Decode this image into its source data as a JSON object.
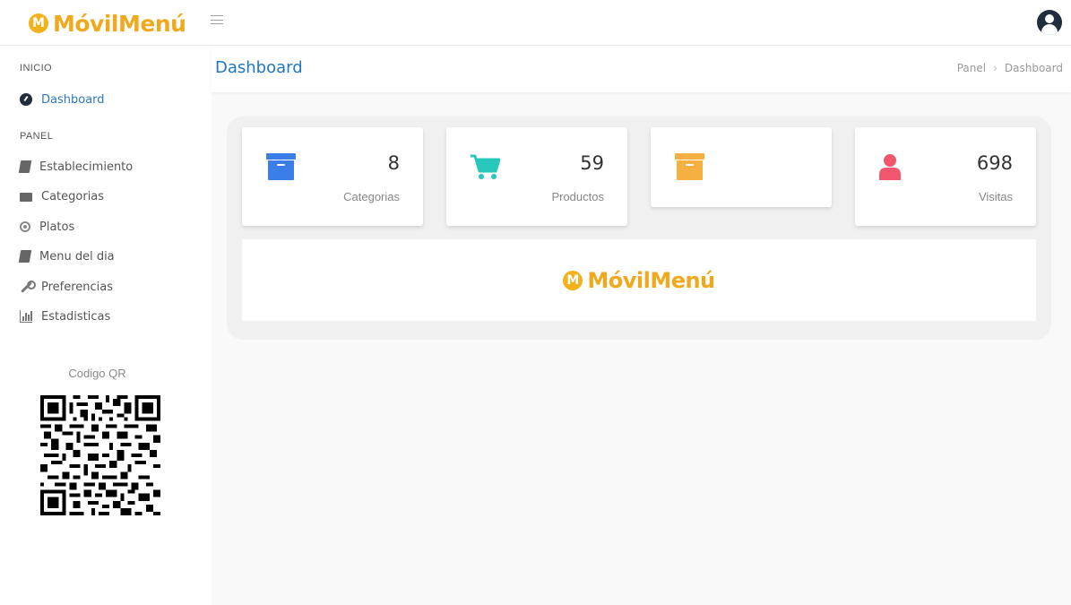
{
  "app": {
    "brand_badge": "M",
    "brand_name": "MóvilMenú"
  },
  "colors": {
    "brand": "#f0a91c",
    "accent": "#1f77c4",
    "categorias_icon": "#3b7de9",
    "productos_icon": "#27c8bb",
    "third_icon": "#f5b041",
    "visitas_icon": "#f0566e"
  },
  "topbar": {
    "menu_icon": "hamburger-icon",
    "user_icon": "user-circle-icon"
  },
  "sidebar": {
    "sections": [
      {
        "title": "INICIO",
        "items": [
          {
            "label": "Dashboard",
            "icon": "dashboard-icon",
            "active": true
          }
        ]
      },
      {
        "title": "PANEL",
        "items": [
          {
            "label": "Establecimiento",
            "icon": "book-icon"
          },
          {
            "label": "Categorias",
            "icon": "folder-icon"
          },
          {
            "label": "Platos",
            "icon": "circle-dot-icon"
          },
          {
            "label": "Menu del dia",
            "icon": "book-icon"
          },
          {
            "label": "Preferencias",
            "icon": "wrench-icon"
          },
          {
            "label": "Estadisticas",
            "icon": "bar-chart-icon"
          }
        ]
      }
    ],
    "qr_label": "Codigo QR"
  },
  "page": {
    "title": "Dashboard",
    "breadcrumb": [
      "Panel",
      "Dashboard"
    ]
  },
  "stats": [
    {
      "value": "8",
      "label": "Categorias",
      "icon": "archive-box-icon"
    },
    {
      "value": "59",
      "label": "Productos",
      "icon": "shopping-cart-icon"
    },
    {
      "value": "",
      "label": "",
      "icon": "archive-box-icon"
    },
    {
      "value": "698",
      "label": "Visitas",
      "icon": "user-icon"
    }
  ],
  "logo_strip": {
    "brand_badge": "M",
    "brand_name": "MóvilMenú"
  }
}
